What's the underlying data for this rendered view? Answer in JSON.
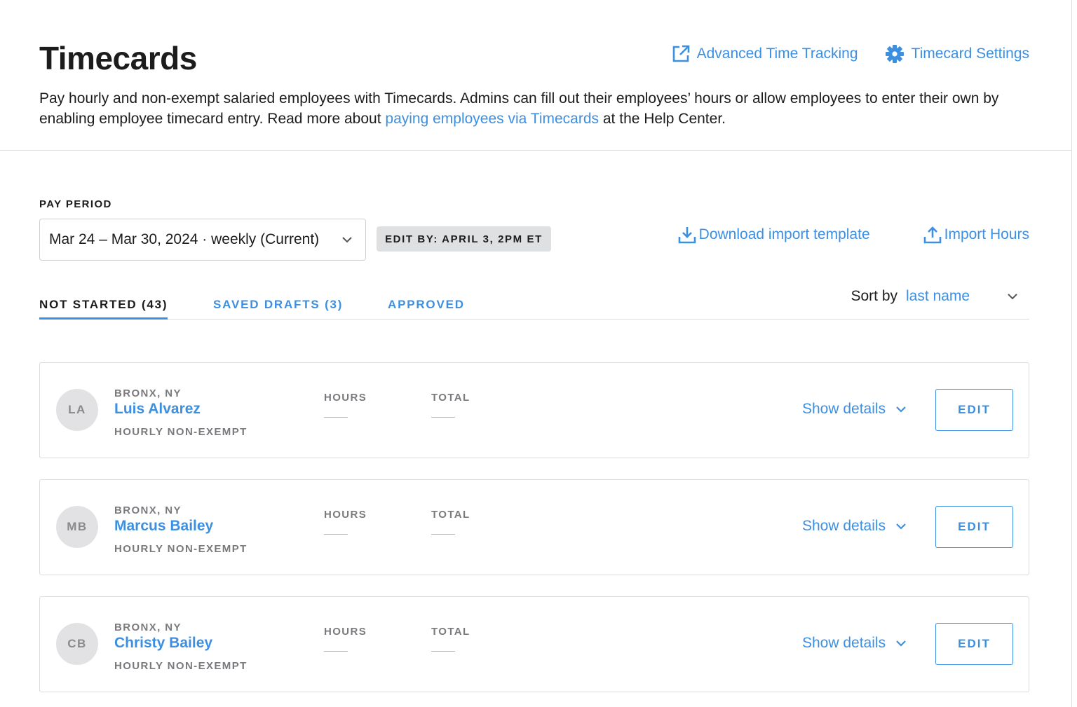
{
  "header": {
    "title": "Timecards",
    "links": {
      "advanced": "Advanced Time Tracking",
      "settings": "Timecard Settings"
    },
    "intro": {
      "text_before": "Pay hourly and non-exempt salaried employees with Timecards. Admins can fill out their employees’ hours or allow employees to enter their own by enabling employee timecard entry. Read more about ",
      "link": "paying employees via Timecards",
      "text_after": " at the Help Center."
    }
  },
  "pay_period": {
    "label": "PAY PERIOD",
    "selected": "Mar 24 – Mar 30, 2024 · weekly (Current)",
    "edit_by": "EDIT BY: APRIL 3, 2PM ET"
  },
  "actions": {
    "download": "Download import template",
    "import": "Import Hours"
  },
  "tabs": [
    {
      "label": "NOT STARTED (43)"
    },
    {
      "label": "SAVED DRAFTS (3)"
    },
    {
      "label": "APPROVED"
    }
  ],
  "sort": {
    "label": "Sort by",
    "value": "last name"
  },
  "employees": [
    {
      "initials": "LA",
      "location": "BRONX, NY",
      "name": "Luis Alvarez",
      "type": "HOURLY NON-EXEMPT",
      "hours_label": "HOURS",
      "total_label": "TOTAL",
      "details": "Show details",
      "edit": "EDIT"
    },
    {
      "initials": "MB",
      "location": "BRONX, NY",
      "name": "Marcus Bailey",
      "type": "HOURLY NON-EXEMPT",
      "hours_label": "HOURS",
      "total_label": "TOTAL",
      "details": "Show details",
      "edit": "EDIT"
    },
    {
      "initials": "CB",
      "location": "BRONX, NY",
      "name": "Christy Bailey",
      "type": "HOURLY NON-EXEMPT",
      "hours_label": "HOURS",
      "total_label": "TOTAL",
      "details": "Show details",
      "edit": "EDIT"
    }
  ],
  "colors": {
    "accent": "#3d8fe0",
    "text": "#1c1c1c",
    "muted": "#7a7a7e",
    "border": "#dcdcdc"
  }
}
